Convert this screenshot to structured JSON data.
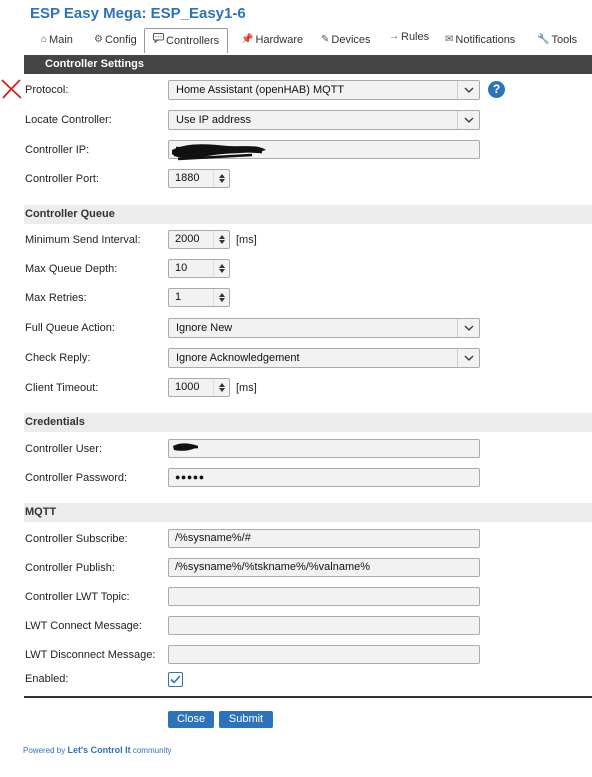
{
  "app_title": "ESP Easy Mega: ESP_Easy1-6",
  "tabs": [
    {
      "label": "Main",
      "icon": "home-icon"
    },
    {
      "label": "Config",
      "icon": "gear-icon"
    },
    {
      "label": "Controllers",
      "icon": "chat-icon",
      "active": true
    },
    {
      "label": "Hardware",
      "icon": "pushpin-icon"
    },
    {
      "label": "Devices",
      "icon": "plug-icon"
    },
    {
      "label": "Rules",
      "icon": "arrow-right-icon"
    },
    {
      "label": "Notifications",
      "icon": "envelope-icon"
    },
    {
      "label": "Tools",
      "icon": "wrench-icon"
    }
  ],
  "sections": {
    "settings": "Controller Settings",
    "queue": "Controller Queue",
    "credentials": "Credentials",
    "mqtt": "MQTT"
  },
  "fields": {
    "protocol": {
      "label": "Protocol:",
      "value": "Home Assistant (openHAB) MQTT"
    },
    "locate": {
      "label": "Locate Controller:",
      "value": "Use IP address"
    },
    "ip": {
      "label": "Controller IP:",
      "value": ""
    },
    "port": {
      "label": "Controller Port:",
      "value": "1880"
    },
    "min_send": {
      "label": "Minimum Send Interval:",
      "value": "2000",
      "unit": "[ms]"
    },
    "max_queue": {
      "label": "Max Queue Depth:",
      "value": "10"
    },
    "max_retries": {
      "label": "Max Retries:",
      "value": "1"
    },
    "full_queue": {
      "label": "Full Queue Action:",
      "value": "Ignore New"
    },
    "check_reply": {
      "label": "Check Reply:",
      "value": "Ignore Acknowledgement"
    },
    "client_timeout": {
      "label": "Client Timeout:",
      "value": "1000",
      "unit": "[ms]"
    },
    "user": {
      "label": "Controller User:",
      "value": ""
    },
    "password": {
      "label": "Controller Password:",
      "value": "●●●●●"
    },
    "subscribe": {
      "label": "Controller Subscribe:",
      "value": "/%sysname%/#"
    },
    "publish": {
      "label": "Controller Publish:",
      "value": "/%sysname%/%tskname%/%valname%"
    },
    "lwt_topic": {
      "label": "Controller LWT Topic:",
      "value": ""
    },
    "lwt_connect": {
      "label": "LWT Connect Message:",
      "value": ""
    },
    "lwt_disconnect": {
      "label": "LWT Disconnect Message:",
      "value": ""
    },
    "enabled": {
      "label": "Enabled:",
      "checked": true
    }
  },
  "help_label": "?",
  "buttons": {
    "close": "Close",
    "submit": "Submit"
  },
  "footer": {
    "prefix": "Powered by",
    "brand": "Let's Control It",
    "suffix": "community"
  },
  "colors": {
    "accent": "#2c73b9",
    "header_bar": "#444444",
    "section_bar": "#ececec",
    "annotation_mark": "#cc2222"
  }
}
